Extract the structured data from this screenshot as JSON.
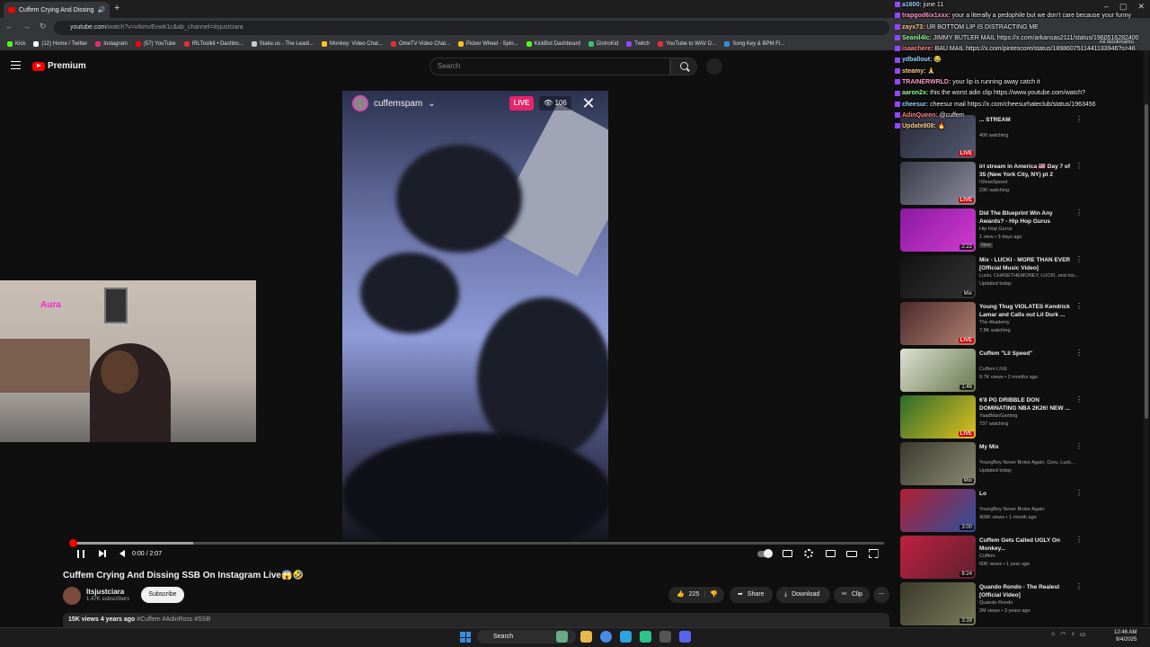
{
  "browser": {
    "tab_title": "Cuffem Crying And Dissing",
    "new_tab": "+",
    "window_controls": [
      "–",
      "▢",
      "✕"
    ],
    "url_host": "youtube.com",
    "url_path": "/watch?v=vIkmvEnwk1c&ab_channel=itsjustciara",
    "bookmarks": [
      {
        "label": "Kick",
        "color": "#53fc18"
      },
      {
        "label": "(12) Home / Twitter",
        "color": "#ffffff"
      },
      {
        "label": "Instagram",
        "color": "#e1306c"
      },
      {
        "label": "(57) YouTube",
        "color": "#ff0000"
      },
      {
        "label": "IRLToolkit • Dashbo...",
        "color": "#e03030"
      },
      {
        "label": "Stake.us - The Leadi...",
        "color": "#cccccc"
      },
      {
        "label": "Monkey: Video Chat...",
        "color": "#f5c518"
      },
      {
        "label": "OmeTV Video Chat...",
        "color": "#e03030"
      },
      {
        "label": "Picker Wheel - Spin...",
        "color": "#f5c518"
      },
      {
        "label": "KickBot Dashboard",
        "color": "#53fc18"
      },
      {
        "label": "DistroKid",
        "color": "#36c26e"
      },
      {
        "label": "Twitch",
        "color": "#9147ff"
      },
      {
        "label": "YouTube to WAV D...",
        "color": "#e03030"
      },
      {
        "label": "Song Key & BPM Fi...",
        "color": "#3a8dde"
      }
    ],
    "all_bookmarks": "All Bookmarks"
  },
  "youtube": {
    "logo_text": "Premium",
    "search_placeholder": "Search"
  },
  "video": {
    "ig_username": "cuffemspam",
    "live_label": "LIVE",
    "viewer_count": "106",
    "close_glyph": "✕",
    "webcam_neon": "Aura",
    "current_time": "0:00",
    "duration": "2:07",
    "time_display": "0:00 / 2:07",
    "progress_fraction": 0.002,
    "buffered_fraction": 0.15
  },
  "meta": {
    "title": "Cuffem Crying And Dissing SSB On Instagram Live😱🤣",
    "channel_name": "Itsjustciara",
    "subscribers": "1.47K subscribers",
    "subscribe_label": "Subscribe",
    "likes": "225",
    "share_label": "Share",
    "download_label": "Download",
    "clip_label": "Clip",
    "views": "15K views",
    "age": "4 years ago",
    "hashtags": "#Cuffem #AdinRoss #SSB"
  },
  "recommendations": [
    {
      "title": "... STREAM",
      "channel": "",
      "stats": "400 watching",
      "badge": "LIVE",
      "live": true,
      "colors": [
        "#2a2a3a",
        "#555a70"
      ]
    },
    {
      "title": "irl stream in America 🇺🇸 Day 7 of 35 (New York City, NY) pt 2",
      "channel": "IShowSpeed",
      "stats": "23K watching",
      "badge": "LIVE",
      "live": true,
      "colors": [
        "#3a3a4a",
        "#8a8a9a"
      ]
    },
    {
      "title": "Did The Blueprint Win Any Awards? - Hip Hop Gurus",
      "channel": "Hip Hop Gurus",
      "stats": "1 view • 3 days ago",
      "extra": "New",
      "badge": "2:22",
      "live": false,
      "colors": [
        "#8a1aa0",
        "#d13bd1"
      ]
    },
    {
      "title": "Mix - LUCKI - MORE THAN EVER [Official Music Video]",
      "channel": "Lucki, CHASETHEMONEY, LUCKI, and mo...",
      "stats": "Updated today",
      "badge": "Mix",
      "live": false,
      "colors": [
        "#111111",
        "#333333"
      ]
    },
    {
      "title": "Young Thug VIOLATES Kendrick Lamar and Calls out Lil Durk ...",
      "channel": "The Akademy",
      "stats": "7.8K watching",
      "badge": "LIVE",
      "live": true,
      "colors": [
        "#4a2a2a",
        "#b08070"
      ]
    },
    {
      "title": "Cuffem \"Lil Speed\"",
      "channel": "Cuffem LIVE",
      "stats": "9.7K views • 2 months ago",
      "badge": "1:46",
      "live": false,
      "colors": [
        "#dde0d0",
        "#6a7a50"
      ]
    },
    {
      "title": "6'8 PG DRIBBLE DON DOMINATING NBA 2K26! NEW ...",
      "channel": "YaadManGaming",
      "stats": "737 watching",
      "badge": "LIVE",
      "live": true,
      "colors": [
        "#2a6a2a",
        "#e0c020"
      ]
    },
    {
      "title": "My Mix",
      "channel": "YoungBoy Never Broke Again, Ceru, Luck...",
      "stats": "Updated today",
      "badge": "Mix",
      "live": false,
      "colors": [
        "#3a3a30",
        "#8a8a70"
      ]
    },
    {
      "title": "Lo",
      "channel": "YoungBoy Never Broke Again",
      "stats": "409K views • 1 month ago",
      "badge": "3:00",
      "live": false,
      "colors": [
        "#b02030",
        "#3050a0"
      ]
    },
    {
      "title": "Cuffem Gets Called UGLY On Monkey...",
      "channel": "Cuffem",
      "stats": "60K views • 1 year ago",
      "badge": "8:24",
      "live": false,
      "colors": [
        "#c02040",
        "#602030"
      ]
    },
    {
      "title": "Quando Rondo - The Realest [Official Video]",
      "channel": "Quando Rondo",
      "stats": "2M views • 3 years ago",
      "badge": "3:39",
      "live": false,
      "colors": [
        "#3a3a2a",
        "#7a7a5a"
      ]
    }
  ],
  "chat": [
    {
      "user": "a1600:",
      "text": "june 11",
      "color": "#9ad0ff"
    },
    {
      "user": "trapgod6ix1xxx:",
      "text": "your a literally a pedophile but we don't care because your funny",
      "color": "#ff9ad0"
    },
    {
      "user": "zayx73:",
      "text": "UR BOTTOM LIP IS DISTRACTING ME",
      "color": "#ffd080"
    },
    {
      "user": "Seanil4lc:",
      "text": "JIMMY BUTLER MAIL https://x.com/arkansas2111/status/1960516282400",
      "color": "#9aff9a"
    },
    {
      "user": "isaachere:",
      "text": "BAU MAIL https://x.com/pintescore/status/1898607511441133946?s=46",
      "color": "#ff8080"
    },
    {
      "user": "ydballout:",
      "text": "😂",
      "color": "#9ad0ff"
    },
    {
      "user": "steamy:",
      "text": "🙏",
      "color": "#ffd080"
    },
    {
      "user": "TRAINERWRLD:",
      "text": "your lip is running away catch it",
      "color": "#ff9ad0"
    },
    {
      "user": "aaron2x:",
      "text": "this the worst adin clip https://www.youtube.com/watch?",
      "color": "#9aff9a"
    },
    {
      "user": "cheesur:",
      "text": "cheesur mail https://x.com/cheesurhateclub/status/1963456",
      "color": "#9ad0ff"
    },
    {
      "user": "AdinQueen:",
      "text": "@cuffem",
      "color": "#ff8080"
    },
    {
      "user": "Update808:",
      "text": "🔥",
      "color": "#ffd080"
    }
  ],
  "taskbar": {
    "search_label": "Search",
    "time": "12:46 AM",
    "date": "9/4/2025"
  },
  "colors": {
    "accent": "#ff0000",
    "live_pink": "#e8246b",
    "background": "#0f0f0f"
  }
}
